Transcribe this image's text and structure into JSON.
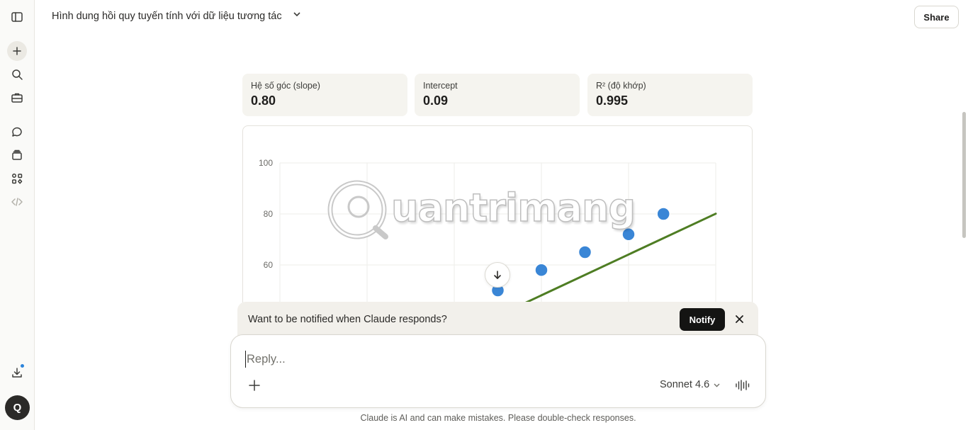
{
  "sidebar": {
    "icons": [
      "sidebar-toggle-icon",
      "plus-icon",
      "search-icon",
      "briefcase-icon",
      "chats-icon",
      "projects-icon",
      "artifacts-icon",
      "code-icon",
      "download-icon"
    ],
    "avatar_letter": "Q"
  },
  "header": {
    "title": "Hình dung hồi quy tuyến tính với dữ liệu tương tác",
    "share_label": "Share"
  },
  "stats": [
    {
      "label": "Hệ số góc (slope)",
      "value": "0.80"
    },
    {
      "label": "Intercept",
      "value": "0.09"
    },
    {
      "label": "R² (độ khớp)",
      "value": "0.995"
    }
  ],
  "chart_data": {
    "type": "scatter",
    "y_ticks": [
      "100",
      "80",
      "60"
    ],
    "ylim": [
      0,
      100
    ],
    "xlim": [
      0,
      100
    ],
    "points": [
      {
        "x": 40,
        "y": 42
      },
      {
        "x": 50,
        "y": 50
      },
      {
        "x": 60,
        "y": 58
      },
      {
        "x": 70,
        "y": 65
      },
      {
        "x": 80,
        "y": 72
      },
      {
        "x": 88,
        "y": 80
      }
    ],
    "fit_line": {
      "slope": 0.8,
      "intercept": 0.09,
      "x_start": 40,
      "x_end": 100
    },
    "point_color": "#3a86d6",
    "line_color": "#4e7d23",
    "grid": true
  },
  "watermark": {
    "text": "uantrimang"
  },
  "notify": {
    "text": "Want to be notified when Claude responds?",
    "button": "Notify"
  },
  "composer": {
    "placeholder": "Reply...",
    "model": "Sonnet 4.6"
  },
  "disclaimer": "Claude is AI and can make mistakes. Please double-check responses."
}
